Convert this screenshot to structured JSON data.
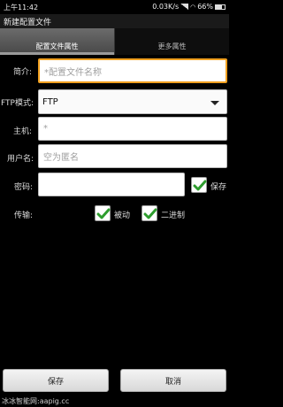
{
  "status_bar": {
    "time": "上午11:42",
    "network_speed": "0.03K/s",
    "battery_percent": "66%"
  },
  "title": "新建配置文件",
  "tabs": [
    {
      "label": "配置文件属性",
      "active": true
    },
    {
      "label": "更多属性",
      "active": false
    }
  ],
  "form": {
    "name_label": "简介:",
    "name_placeholder": "*配置文件名称",
    "ftp_mode_label": "FTP模式:",
    "ftp_mode_value": "FTP",
    "host_label": "主机:",
    "host_placeholder": "*",
    "username_label": "用户名:",
    "username_placeholder": "空为匿名",
    "password_label": "密码:",
    "password_value": "",
    "save_password_label": "保存",
    "transfer_label": "传输:",
    "passive_label": "被动",
    "binary_label": "二进制"
  },
  "checkboxes": {
    "save_password": true,
    "passive": true,
    "binary": true
  },
  "buttons": {
    "save": "保存",
    "cancel": "取消"
  },
  "footer": "冰冰智能网:aapig.cc",
  "colors": {
    "focus_border": "#f0a020",
    "check_green": "#2e9d2e",
    "background": "#000000"
  }
}
